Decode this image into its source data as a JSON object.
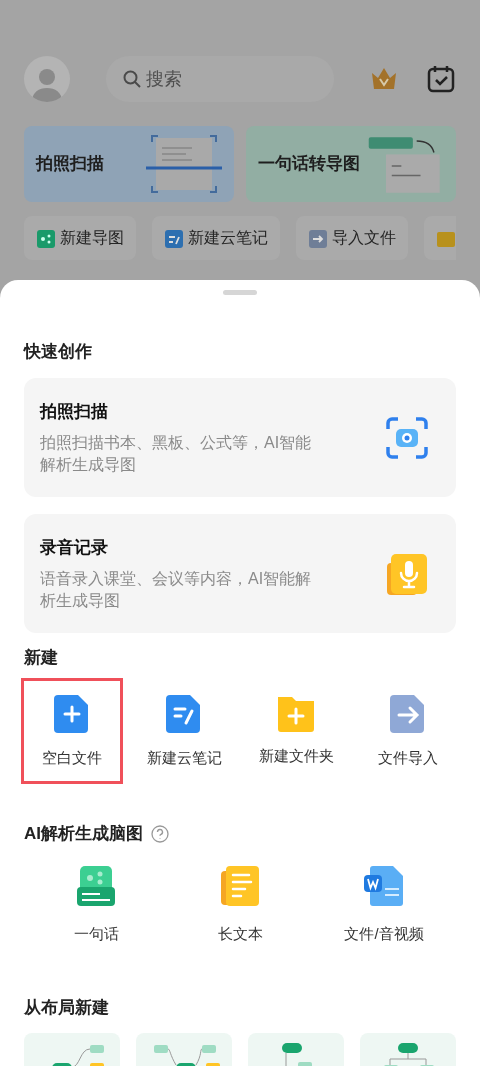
{
  "header": {
    "search": {
      "placeholder": "搜索"
    }
  },
  "banners": [
    {
      "kind": "scan",
      "title": "拍照扫描"
    },
    {
      "kind": "sentence",
      "title": "一句话转导图"
    }
  ],
  "chips": [
    {
      "kind": "mindmap",
      "label": "新建导图"
    },
    {
      "kind": "note",
      "label": "新建云笔记"
    },
    {
      "kind": "import",
      "label": "导入文件"
    },
    {
      "kind": "folder"
    }
  ],
  "sheet": {
    "quick_title": "快速创作",
    "quick": [
      {
        "kind": "camera",
        "title": "拍照扫描",
        "description": "拍照扫描书本、黑板、公式等，AI智能解析生成导图"
      },
      {
        "kind": "mic",
        "title": "录音记录",
        "description": "语音录入课堂、会议等内容，AI智能解析生成导图"
      }
    ],
    "new_title": "新建",
    "new_items": [
      {
        "kind": "blank",
        "label": "空白文件",
        "highlighted": true
      },
      {
        "kind": "note",
        "label": "新建云笔记",
        "highlighted": false
      },
      {
        "kind": "folder",
        "label": "新建文件夹",
        "highlighted": false
      },
      {
        "kind": "import",
        "label": "文件导入",
        "highlighted": false
      }
    ],
    "ai_title": "AI解析生成脑图",
    "ai_items": [
      {
        "kind": "sentence",
        "label": "一句话"
      },
      {
        "kind": "longtext",
        "label": "长文本"
      },
      {
        "kind": "file",
        "label": "文件/音视频"
      }
    ],
    "layout_title": "从布局新建",
    "layouts": [
      {
        "kind": "right"
      },
      {
        "kind": "both"
      },
      {
        "kind": "tree"
      },
      {
        "kind": "org"
      }
    ]
  }
}
